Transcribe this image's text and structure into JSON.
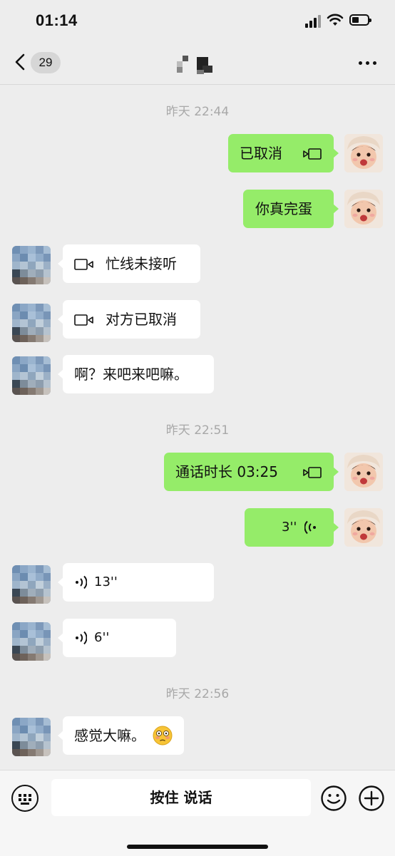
{
  "status_bar": {
    "time": "01:14",
    "battery_level": 0.25
  },
  "nav": {
    "unread_count": "29",
    "more_icon": "more-dots-icon",
    "back_icon": "chevron-left-icon"
  },
  "messages": {
    "ts1": "昨天 22:44",
    "m1": "已取消",
    "m2": "你真完蛋",
    "m3": "忙线未接听",
    "m4": "对方已取消",
    "m5": "啊？来吧来吧嘛。",
    "ts2": "昨天 22:51",
    "m6": "通话时长 03:25",
    "m7": "3''",
    "m8": "13''",
    "m9": "6''",
    "ts3": "昨天 22:56",
    "m10": "感觉大嘛。"
  },
  "input": {
    "hold_to_talk": "按住 说话"
  },
  "colors": {
    "outgoing_bubble": "#95ec69",
    "incoming_bubble": "#ffffff",
    "background": "#ededed"
  }
}
